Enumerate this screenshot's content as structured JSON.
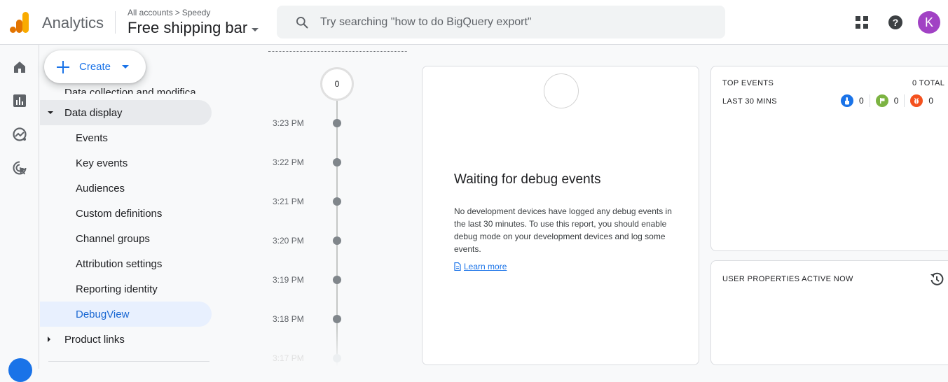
{
  "header": {
    "app_name": "Analytics",
    "breadcrumb": {
      "account": "All accounts",
      "separator": ">",
      "property": "Speedy"
    },
    "property_name": "Free shipping bar",
    "search": {
      "placeholder": "Try searching \"how to do BigQuery export\"",
      "value": ""
    },
    "icons": [
      "apps-grid-icon",
      "help-icon"
    ],
    "avatar_initial": "K"
  },
  "rail": {
    "items": [
      "home-icon",
      "reports-icon",
      "explore-icon",
      "advertising-icon"
    ],
    "bottom": "admin-gear-icon"
  },
  "nav": {
    "create_label": "Create",
    "items": [
      {
        "label": "Data collection and modifica...",
        "type": "parent-collapsed-cut"
      },
      {
        "label": "Data display",
        "type": "parent-expanded"
      },
      {
        "label": "Events",
        "type": "sub"
      },
      {
        "label": "Key events",
        "type": "sub"
      },
      {
        "label": "Audiences",
        "type": "sub"
      },
      {
        "label": "Custom definitions",
        "type": "sub"
      },
      {
        "label": "Channel groups",
        "type": "sub"
      },
      {
        "label": "Attribution settings",
        "type": "sub"
      },
      {
        "label": "Reporting identity",
        "type": "sub"
      },
      {
        "label": "DebugView",
        "type": "sub-active"
      },
      {
        "label": "Product links",
        "type": "parent-collapsed"
      }
    ]
  },
  "timeline": {
    "counter": "0",
    "times": [
      "3:23 PM",
      "3:22 PM",
      "3:21 PM",
      "3:20 PM",
      "3:19 PM",
      "3:18 PM",
      "3:17 PM"
    ]
  },
  "main_card": {
    "title": "Waiting for debug events",
    "description": "No development devices have logged any debug events in the last 30 minutes. To use this report, you should enable debug mode on your development devices and log some events.",
    "learn_more": "Learn more"
  },
  "top_events": {
    "title": "TOP EVENTS",
    "total": "0 TOTAL",
    "period": "LAST 30 MINS",
    "counts": [
      {
        "icon": "touch-icon",
        "color": "#1a73e8",
        "value": "0"
      },
      {
        "icon": "flag-icon",
        "color": "#7cb342",
        "value": "0"
      },
      {
        "icon": "bug-icon",
        "color": "#f4511e",
        "value": "0"
      }
    ]
  },
  "user_properties": {
    "title": "USER PROPERTIES ACTIVE NOW"
  },
  "colors": {
    "accent": "#1a73e8",
    "avatar": "#a142c4",
    "logo_dark": "#e37400",
    "logo_light": "#f9ab00"
  }
}
